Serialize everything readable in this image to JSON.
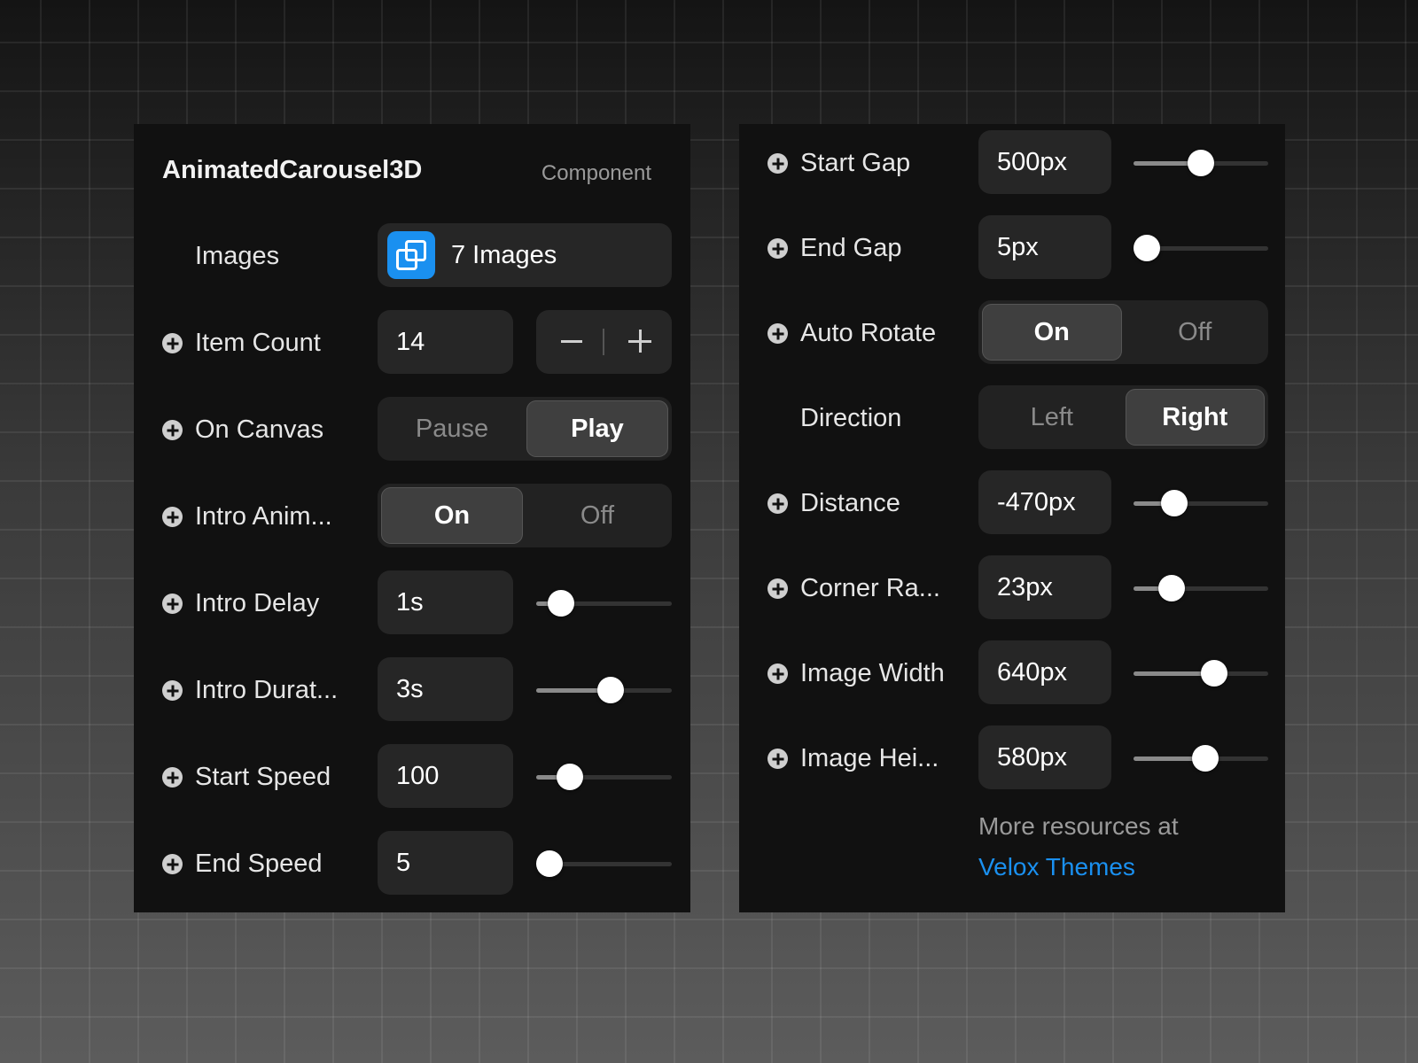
{
  "header": {
    "title": "AnimatedCarousel3D",
    "type": "Component"
  },
  "left": {
    "images": {
      "label": "Images",
      "value": "7 Images"
    },
    "item_count": {
      "label": "Item Count",
      "value": "14"
    },
    "on_canvas": {
      "label": "On Canvas",
      "options": [
        "Pause",
        "Play"
      ],
      "selected": "Play"
    },
    "intro_anim": {
      "label": "Intro Anim...",
      "options": [
        "On",
        "Off"
      ],
      "selected": "On"
    },
    "intro_delay": {
      "label": "Intro Delay",
      "value": "1s",
      "level": 0.18
    },
    "intro_duration": {
      "label": "Intro Durat...",
      "value": "3s",
      "level": 0.55
    },
    "start_speed": {
      "label": "Start Speed",
      "value": "100",
      "level": 0.25
    },
    "end_speed": {
      "label": "End Speed",
      "value": "5",
      "level": 0.1
    }
  },
  "right": {
    "start_gap": {
      "label": "Start Gap",
      "value": "500px",
      "level": 0.5
    },
    "end_gap": {
      "label": "End Gap",
      "value": "5px",
      "level": 0.1
    },
    "auto_rotate": {
      "label": "Auto Rotate",
      "options": [
        "On",
        "Off"
      ],
      "selected": "On"
    },
    "direction": {
      "label": "Direction",
      "options": [
        "Left",
        "Right"
      ],
      "selected": "Right"
    },
    "distance": {
      "label": "Distance",
      "value": "-470px",
      "level": 0.3
    },
    "corner_radius": {
      "label": "Corner Ra...",
      "value": "23px",
      "level": 0.28
    },
    "image_width": {
      "label": "Image Width",
      "value": "640px",
      "level": 0.6
    },
    "image_height": {
      "label": "Image Hei...",
      "value": "580px",
      "level": 0.53
    }
  },
  "footer": {
    "text": "More resources at",
    "link": "Velox Themes"
  },
  "colors": {
    "accent": "#1a90f0",
    "panel": "#111111",
    "field": "#262626"
  },
  "icons": {
    "add": "plus-circle-icon",
    "images": "images-icon"
  }
}
